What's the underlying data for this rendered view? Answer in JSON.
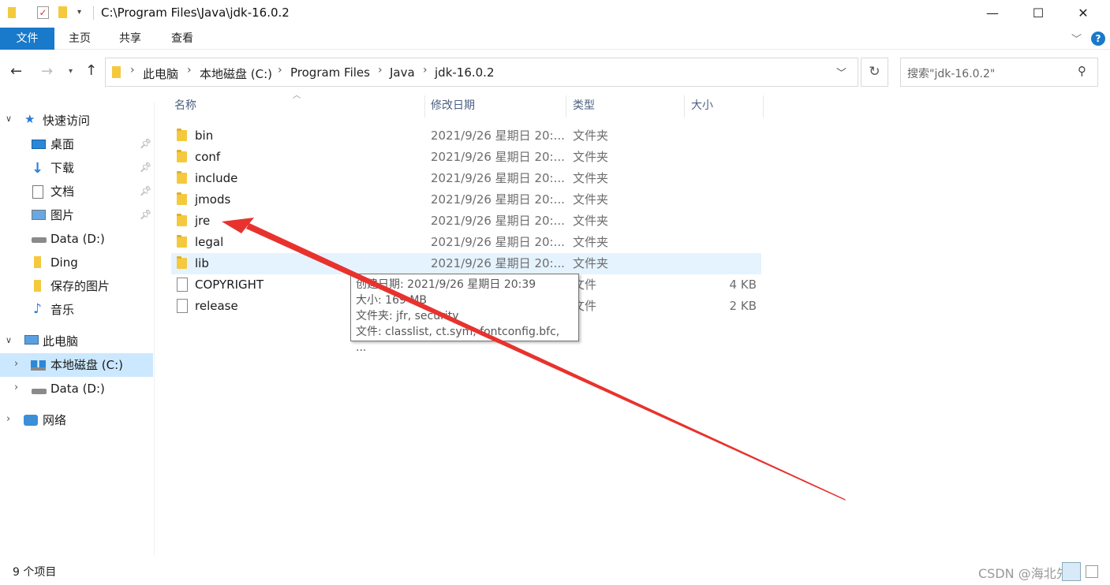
{
  "titlebar": {
    "path": "C:\\Program Files\\Java\\jdk-16.0.2",
    "minimize": "—",
    "maximize": "☐",
    "close": "✕"
  },
  "ribbon": {
    "file": "文件",
    "home": "主页",
    "share": "共享",
    "view": "查看"
  },
  "address": {
    "crumbs": [
      "此电脑",
      "本地磁盘 (C:)",
      "Program Files",
      "Java",
      "jdk-16.0.2"
    ]
  },
  "search": {
    "placeholder": "搜索\"jdk-16.0.2\""
  },
  "nav": {
    "quick_access": "快速访问",
    "items": [
      "桌面",
      "下载",
      "文档",
      "图片",
      "Data (D:)",
      "Ding",
      "保存的图片",
      "音乐"
    ],
    "this_pc": "此电脑",
    "drive_c": "本地磁盘 (C:)",
    "drive_d": "Data (D:)",
    "network": "网络"
  },
  "columns": {
    "name": "名称",
    "date": "修改日期",
    "type": "类型",
    "size": "大小"
  },
  "files": [
    {
      "name": "bin",
      "date": "2021/9/26 星期日 20:...",
      "type": "文件夹",
      "size": ""
    },
    {
      "name": "conf",
      "date": "2021/9/26 星期日 20:...",
      "type": "文件夹",
      "size": ""
    },
    {
      "name": "include",
      "date": "2021/9/26 星期日 20:...",
      "type": "文件夹",
      "size": ""
    },
    {
      "name": "jmods",
      "date": "2021/9/26 星期日 20:...",
      "type": "文件夹",
      "size": ""
    },
    {
      "name": "jre",
      "date": "2021/9/26 星期日 20:...",
      "type": "文件夹",
      "size": ""
    },
    {
      "name": "legal",
      "date": "2021/9/26 星期日 20:...",
      "type": "文件夹",
      "size": ""
    },
    {
      "name": "lib",
      "date": "2021/9/26 星期日 20:...",
      "type": "文件夹",
      "size": ""
    },
    {
      "name": "COPYRIGHT",
      "date": "",
      "type": "文件",
      "size": "4 KB"
    },
    {
      "name": "release",
      "date": "",
      "type": "文件",
      "size": "2 KB"
    }
  ],
  "tooltip": {
    "created": "创建日期: 2021/9/26 星期日 20:39",
    "size": "大小: 169 MB",
    "folders": "文件夹: jfr, security",
    "files": "文件: classlist, ct.sym, fontconfig.bfc, ..."
  },
  "status": {
    "count": "9 个项目"
  },
  "watermark": "CSDN @海北先生",
  "colors": {
    "accent": "#1979ca",
    "selected": "#cce8ff",
    "hover": "#e5f3ff",
    "arrow": "#e8322e"
  }
}
